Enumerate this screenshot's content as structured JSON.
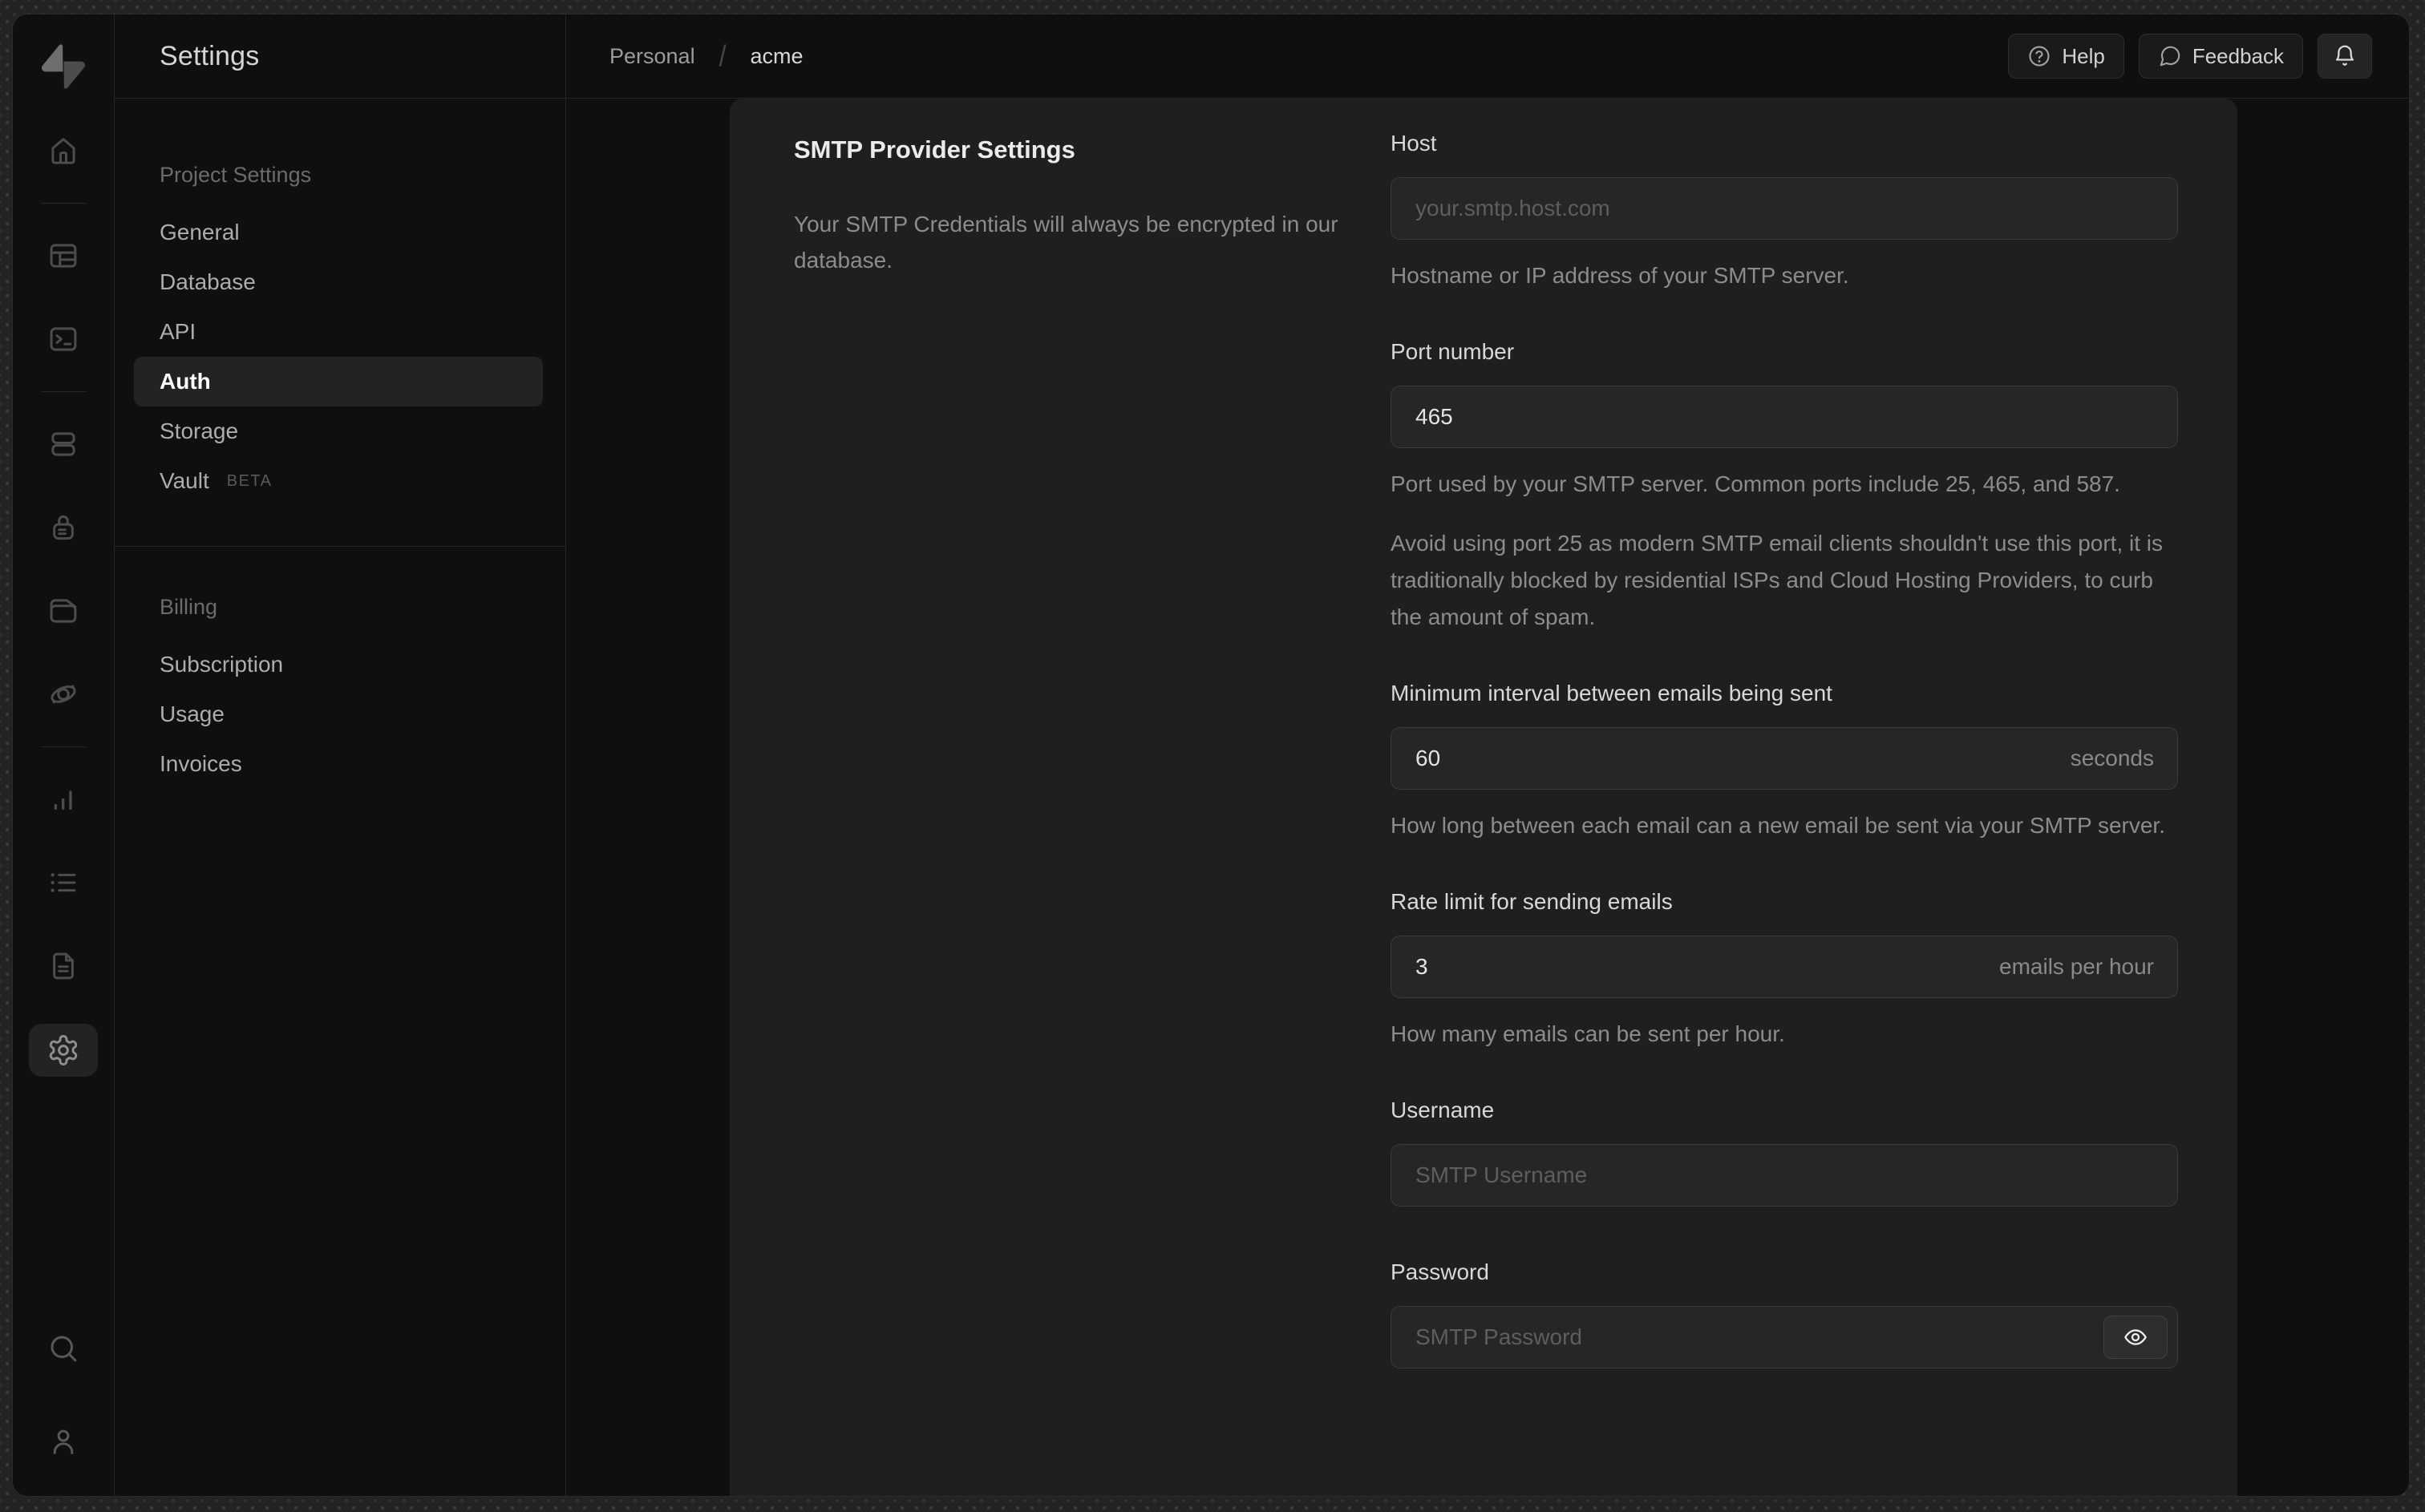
{
  "colors": {
    "desktop_bg": "#232323",
    "window_bg": "#0f0f0f",
    "panel_bg": "#1f1f1f",
    "input_bg": "#262626",
    "input_border": "#3a3a3a",
    "active_pill_bg": "#232323",
    "active_text": "#ffffff",
    "muted_text": "#8c8c8c"
  },
  "rail": {
    "icons": [
      "supabase-logo",
      "home",
      "table-editor",
      "sql-editor",
      "database",
      "auth",
      "storage",
      "edge-functions",
      "reports",
      "logs",
      "docs",
      "settings",
      "search",
      "user"
    ],
    "active_icon": "settings"
  },
  "sidebar": {
    "title": "Settings",
    "sections": [
      {
        "header": "Project Settings",
        "items": [
          {
            "label": "General"
          },
          {
            "label": "Database"
          },
          {
            "label": "API"
          },
          {
            "label": "Auth",
            "active": true
          },
          {
            "label": "Storage"
          },
          {
            "label": "Vault",
            "badge": "BETA"
          }
        ]
      },
      {
        "header": "Billing",
        "items": [
          {
            "label": "Subscription"
          },
          {
            "label": "Usage"
          },
          {
            "label": "Invoices"
          }
        ]
      }
    ]
  },
  "topbar": {
    "breadcrumb": {
      "items": [
        "Personal",
        "acme"
      ],
      "separator": "/"
    },
    "help_label": "Help",
    "feedback_label": "Feedback"
  },
  "panel": {
    "heading": "SMTP Provider Settings",
    "description": "Your SMTP Credentials will always be encrypted in our database.",
    "fields": {
      "host": {
        "label": "Host",
        "placeholder": "your.smtp.host.com",
        "helper": "Hostname or IP address of your SMTP server."
      },
      "port": {
        "label": "Port number",
        "value": "465",
        "helper1": "Port used by your SMTP server. Common ports include 25, 465, and 587.",
        "helper2": "Avoid using port 25 as modern SMTP email clients shouldn't use this port, it is traditionally blocked by residential ISPs and Cloud Hosting Providers, to curb the amount of spam."
      },
      "interval": {
        "label": "Minimum interval between emails being sent",
        "value": "60",
        "suffix": "seconds",
        "helper": "How long between each email can a new email be sent via your SMTP server."
      },
      "rate": {
        "label": "Rate limit for sending emails",
        "value": "3",
        "suffix": "emails per hour",
        "helper": "How many emails can be sent per hour."
      },
      "username": {
        "label": "Username",
        "placeholder": "SMTP Username"
      },
      "password": {
        "label": "Password",
        "placeholder": "SMTP Password"
      }
    }
  }
}
